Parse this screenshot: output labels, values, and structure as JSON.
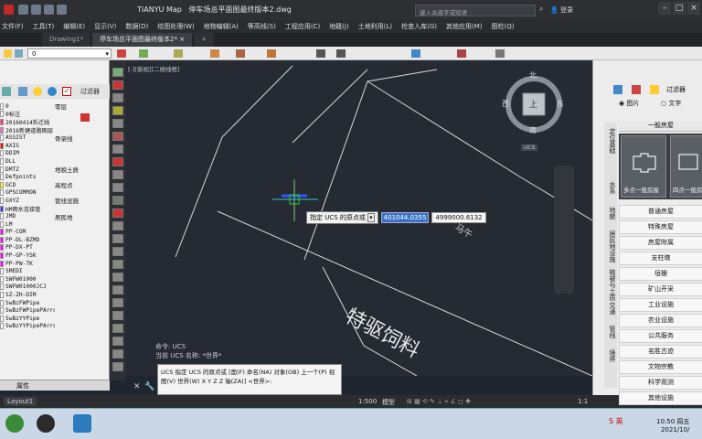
{
  "app": {
    "title": "TIANYU Map",
    "document": "停车场总平面图最终版本2.dwg",
    "search_placeholder": "键入关键字或短语",
    "login": "登录"
  },
  "menu": [
    "文件(F)",
    "工具(T)",
    "编辑(E)",
    "显示(V)",
    "数据(D)",
    "绘图处理(W)",
    "地物编辑(A)",
    "等高线(S)",
    "工程应用(C)",
    "地籍(J)",
    "土地利用(L)",
    "检查入库(G)",
    "其他应用(M)",
    "图检(Q)"
  ],
  "tabs": [
    {
      "label": "Drawing1*"
    },
    {
      "label": "停车场总平面图最终版本2*"
    },
    {
      "label": "+"
    }
  ],
  "layer_select": "0",
  "left_panel": {
    "filter_label": "过滤器",
    "layers": [
      {
        "name": "0",
        "color": "#ffffff",
        "category": "零层"
      },
      {
        "name": "0标注",
        "color": "#ffffff",
        "category": ""
      },
      {
        "name": "20160414拆迁线",
        "color": "#ff3366",
        "category": ""
      },
      {
        "name": "2016新建道路图层",
        "color": "#ff66cc",
        "category": ""
      },
      {
        "name": "ASSIST",
        "color": "#ffffff",
        "category": "骨架线"
      },
      {
        "name": "AXIS",
        "color": "#ff0000",
        "category": ""
      },
      {
        "name": "DDIM",
        "color": "#ffffff",
        "category": ""
      },
      {
        "name": "DLL",
        "color": "#ffffff",
        "category": ""
      },
      {
        "name": "DMTZ",
        "color": "#ffffff",
        "category": "地貌土质"
      },
      {
        "name": "Defpoints",
        "color": "#ffffff",
        "category": ""
      },
      {
        "name": "GCD",
        "color": "#ffff00",
        "category": "高程点"
      },
      {
        "name": "GPSCOMMON",
        "color": "#ffffff",
        "category": ""
      },
      {
        "name": "GXYZ",
        "color": "#ffffff",
        "category": "管线设施"
      },
      {
        "name": "HM雨水连接管",
        "color": "#3333ff",
        "category": ""
      },
      {
        "name": "JMD",
        "color": "#ffffff",
        "category": "居民地"
      },
      {
        "name": "LM",
        "color": "#ffffff",
        "category": ""
      },
      {
        "name": "PP-COM",
        "color": "#ff00ff",
        "category": ""
      },
      {
        "name": "PP-DL-BZMD",
        "color": "#ff00ff",
        "category": ""
      },
      {
        "name": "PP-DX-PT",
        "color": "#ff00ff",
        "category": ""
      },
      {
        "name": "PP-GP-YSK",
        "color": "#ff00ff",
        "category": ""
      },
      {
        "name": "PP-PW-TK",
        "color": "#ff00ff",
        "category": ""
      },
      {
        "name": "SMEDI",
        "color": "#ffffff",
        "category": ""
      },
      {
        "name": "SWFW01000",
        "color": "#ffffff",
        "category": ""
      },
      {
        "name": "SWFW01000JCJ",
        "color": "#ffffff",
        "category": ""
      },
      {
        "name": "SZ-ZH-DIM",
        "color": "#ffffff",
        "category": ""
      },
      {
        "name": "SwBzFWPipe",
        "color": "#ffffff",
        "category": ""
      },
      {
        "name": "SwBzFWPipePArrow",
        "color": "#ffffff",
        "category": ""
      },
      {
        "name": "SwBzYYPipe",
        "color": "#ffffff",
        "category": ""
      },
      {
        "name": "SwBzYYPipePArrow",
        "color": "#ffffff",
        "category": ""
      }
    ],
    "properties_label": "属性"
  },
  "canvas": {
    "view_label": "[-][俯视][二维线框]",
    "compass": {
      "n": "北",
      "s": "南",
      "e": "东",
      "w": "西",
      "top": "上",
      "ucs": "UCS"
    },
    "tooltip_label": "指定 UCS 的原点或",
    "coord_x": "401044.0355",
    "coord_y": "4999000.6132",
    "drawing_text": "特驱饲料",
    "drawing_text2": "马午"
  },
  "command": {
    "history1": "命令: UCS",
    "history2": "当前 UCS 名称: *世界*",
    "prompt": "UCS 指定 UCS 的原点或 [面(F) 命名(NA) 对象(OB) 上一个(P) 视图(V) 世界(W) X Y Z Z 轴(ZA)] <世界>:"
  },
  "status": {
    "layout_tab": "Layout1",
    "scale": "1:500",
    "model": "模型",
    "ratio": "1:1"
  },
  "right_panel": {
    "filter_label": "过滤器",
    "radio_image": "图片",
    "radio_text": "文字",
    "category_title": "一般房屋",
    "thumb1": "多点一般房屋",
    "thumb2": "四点一般房",
    "vertical_tabs": [
      "定位基础",
      "水系",
      "地貌",
      "居民地设施",
      "植被与土质",
      "交通",
      "管线",
      "境界"
    ],
    "categories": [
      "普通房屋",
      "特殊房屋",
      "房屋附属",
      "支柱墩",
      "垣栅",
      "矿山开采",
      "工业设施",
      "农业设施",
      "公共服务",
      "名胜古迹",
      "文物宗教",
      "科学观测",
      "其他设施"
    ]
  },
  "taskbar": {
    "time": "10:50 周五",
    "date": "2021/10/"
  },
  "colors": {
    "canvas": "#252a33",
    "accent": "#3b73c9"
  }
}
